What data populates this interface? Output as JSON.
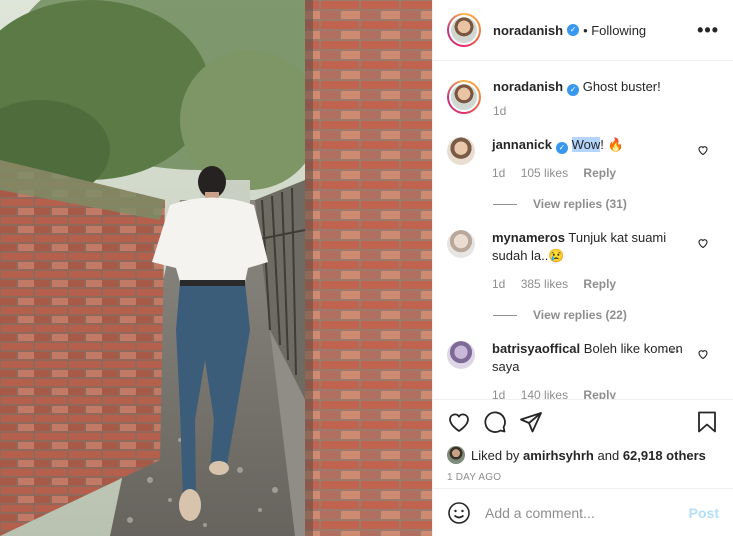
{
  "post": {
    "username": "noradanish",
    "follow_status": "• Following",
    "more_label": "•••"
  },
  "caption": {
    "username": "noradanish",
    "text": "Ghost buster!",
    "time": "1d"
  },
  "comments": [
    {
      "username": "jannanick",
      "text_highlighted": "Wow",
      "text_rest": "! 🔥",
      "time": "1d",
      "likes": "105 likes",
      "reply_label": "Reply",
      "view_replies": "View replies (31)"
    },
    {
      "username": "mynameros",
      "text": "Tunjuk kat suami sudah la..😢",
      "time": "1d",
      "likes": "385 likes",
      "reply_label": "Reply",
      "view_replies": "View replies (22)"
    },
    {
      "username": "batrisyaoffical",
      "text": "Boleh like komen saya",
      "time": "1d",
      "likes": "140 likes",
      "reply_label": "Reply"
    }
  ],
  "likes": {
    "prefix": "Liked by",
    "user": "amirhsyhrh",
    "joiner": "and",
    "others": "62,918 others"
  },
  "timestamp": "1 DAY AGO",
  "add_comment": {
    "placeholder": "Add a comment...",
    "post_label": "Post"
  },
  "icons": {
    "verified": "verified-badge-icon",
    "like": "heart-icon",
    "comment": "comment-bubble-icon",
    "share": "paper-plane-icon",
    "save": "bookmark-icon",
    "emoji": "smiley-icon",
    "more": "more-options-icon"
  },
  "colors": {
    "verified_blue": "#3897f0",
    "post_button_disabled": "#b2dffc",
    "meta_gray": "#8e8e8e",
    "text": "#262626"
  }
}
